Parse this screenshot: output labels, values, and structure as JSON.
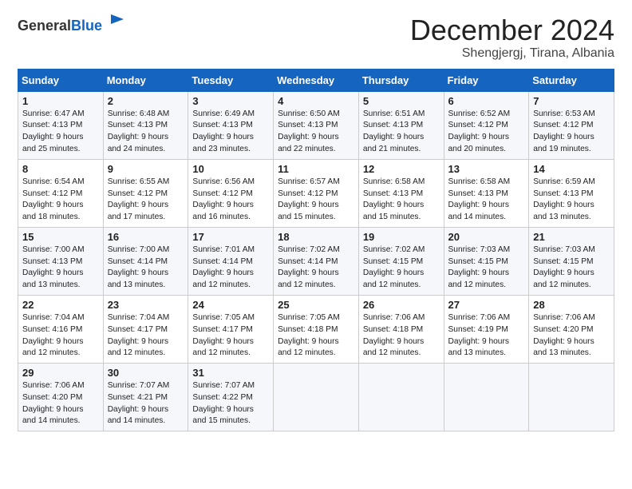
{
  "header": {
    "logo_general": "General",
    "logo_blue": "Blue",
    "month_title": "December 2024",
    "location": "Shengjergj, Tirana, Albania"
  },
  "weekdays": [
    "Sunday",
    "Monday",
    "Tuesday",
    "Wednesday",
    "Thursday",
    "Friday",
    "Saturday"
  ],
  "weeks": [
    [
      {
        "day": "1",
        "sunrise": "Sunrise: 6:47 AM",
        "sunset": "Sunset: 4:13 PM",
        "daylight": "Daylight: 9 hours and 25 minutes."
      },
      {
        "day": "2",
        "sunrise": "Sunrise: 6:48 AM",
        "sunset": "Sunset: 4:13 PM",
        "daylight": "Daylight: 9 hours and 24 minutes."
      },
      {
        "day": "3",
        "sunrise": "Sunrise: 6:49 AM",
        "sunset": "Sunset: 4:13 PM",
        "daylight": "Daylight: 9 hours and 23 minutes."
      },
      {
        "day": "4",
        "sunrise": "Sunrise: 6:50 AM",
        "sunset": "Sunset: 4:13 PM",
        "daylight": "Daylight: 9 hours and 22 minutes."
      },
      {
        "day": "5",
        "sunrise": "Sunrise: 6:51 AM",
        "sunset": "Sunset: 4:13 PM",
        "daylight": "Daylight: 9 hours and 21 minutes."
      },
      {
        "day": "6",
        "sunrise": "Sunrise: 6:52 AM",
        "sunset": "Sunset: 4:12 PM",
        "daylight": "Daylight: 9 hours and 20 minutes."
      },
      {
        "day": "7",
        "sunrise": "Sunrise: 6:53 AM",
        "sunset": "Sunset: 4:12 PM",
        "daylight": "Daylight: 9 hours and 19 minutes."
      }
    ],
    [
      {
        "day": "8",
        "sunrise": "Sunrise: 6:54 AM",
        "sunset": "Sunset: 4:12 PM",
        "daylight": "Daylight: 9 hours and 18 minutes."
      },
      {
        "day": "9",
        "sunrise": "Sunrise: 6:55 AM",
        "sunset": "Sunset: 4:12 PM",
        "daylight": "Daylight: 9 hours and 17 minutes."
      },
      {
        "day": "10",
        "sunrise": "Sunrise: 6:56 AM",
        "sunset": "Sunset: 4:12 PM",
        "daylight": "Daylight: 9 hours and 16 minutes."
      },
      {
        "day": "11",
        "sunrise": "Sunrise: 6:57 AM",
        "sunset": "Sunset: 4:12 PM",
        "daylight": "Daylight: 9 hours and 15 minutes."
      },
      {
        "day": "12",
        "sunrise": "Sunrise: 6:58 AM",
        "sunset": "Sunset: 4:13 PM",
        "daylight": "Daylight: 9 hours and 15 minutes."
      },
      {
        "day": "13",
        "sunrise": "Sunrise: 6:58 AM",
        "sunset": "Sunset: 4:13 PM",
        "daylight": "Daylight: 9 hours and 14 minutes."
      },
      {
        "day": "14",
        "sunrise": "Sunrise: 6:59 AM",
        "sunset": "Sunset: 4:13 PM",
        "daylight": "Daylight: 9 hours and 13 minutes."
      }
    ],
    [
      {
        "day": "15",
        "sunrise": "Sunrise: 7:00 AM",
        "sunset": "Sunset: 4:13 PM",
        "daylight": "Daylight: 9 hours and 13 minutes."
      },
      {
        "day": "16",
        "sunrise": "Sunrise: 7:00 AM",
        "sunset": "Sunset: 4:14 PM",
        "daylight": "Daylight: 9 hours and 13 minutes."
      },
      {
        "day": "17",
        "sunrise": "Sunrise: 7:01 AM",
        "sunset": "Sunset: 4:14 PM",
        "daylight": "Daylight: 9 hours and 12 minutes."
      },
      {
        "day": "18",
        "sunrise": "Sunrise: 7:02 AM",
        "sunset": "Sunset: 4:14 PM",
        "daylight": "Daylight: 9 hours and 12 minutes."
      },
      {
        "day": "19",
        "sunrise": "Sunrise: 7:02 AM",
        "sunset": "Sunset: 4:15 PM",
        "daylight": "Daylight: 9 hours and 12 minutes."
      },
      {
        "day": "20",
        "sunrise": "Sunrise: 7:03 AM",
        "sunset": "Sunset: 4:15 PM",
        "daylight": "Daylight: 9 hours and 12 minutes."
      },
      {
        "day": "21",
        "sunrise": "Sunrise: 7:03 AM",
        "sunset": "Sunset: 4:15 PM",
        "daylight": "Daylight: 9 hours and 12 minutes."
      }
    ],
    [
      {
        "day": "22",
        "sunrise": "Sunrise: 7:04 AM",
        "sunset": "Sunset: 4:16 PM",
        "daylight": "Daylight: 9 hours and 12 minutes."
      },
      {
        "day": "23",
        "sunrise": "Sunrise: 7:04 AM",
        "sunset": "Sunset: 4:17 PM",
        "daylight": "Daylight: 9 hours and 12 minutes."
      },
      {
        "day": "24",
        "sunrise": "Sunrise: 7:05 AM",
        "sunset": "Sunset: 4:17 PM",
        "daylight": "Daylight: 9 hours and 12 minutes."
      },
      {
        "day": "25",
        "sunrise": "Sunrise: 7:05 AM",
        "sunset": "Sunset: 4:18 PM",
        "daylight": "Daylight: 9 hours and 12 minutes."
      },
      {
        "day": "26",
        "sunrise": "Sunrise: 7:06 AM",
        "sunset": "Sunset: 4:18 PM",
        "daylight": "Daylight: 9 hours and 12 minutes."
      },
      {
        "day": "27",
        "sunrise": "Sunrise: 7:06 AM",
        "sunset": "Sunset: 4:19 PM",
        "daylight": "Daylight: 9 hours and 13 minutes."
      },
      {
        "day": "28",
        "sunrise": "Sunrise: 7:06 AM",
        "sunset": "Sunset: 4:20 PM",
        "daylight": "Daylight: 9 hours and 13 minutes."
      }
    ],
    [
      {
        "day": "29",
        "sunrise": "Sunrise: 7:06 AM",
        "sunset": "Sunset: 4:20 PM",
        "daylight": "Daylight: 9 hours and 14 minutes."
      },
      {
        "day": "30",
        "sunrise": "Sunrise: 7:07 AM",
        "sunset": "Sunset: 4:21 PM",
        "daylight": "Daylight: 9 hours and 14 minutes."
      },
      {
        "day": "31",
        "sunrise": "Sunrise: 7:07 AM",
        "sunset": "Sunset: 4:22 PM",
        "daylight": "Daylight: 9 hours and 15 minutes."
      },
      null,
      null,
      null,
      null
    ]
  ]
}
